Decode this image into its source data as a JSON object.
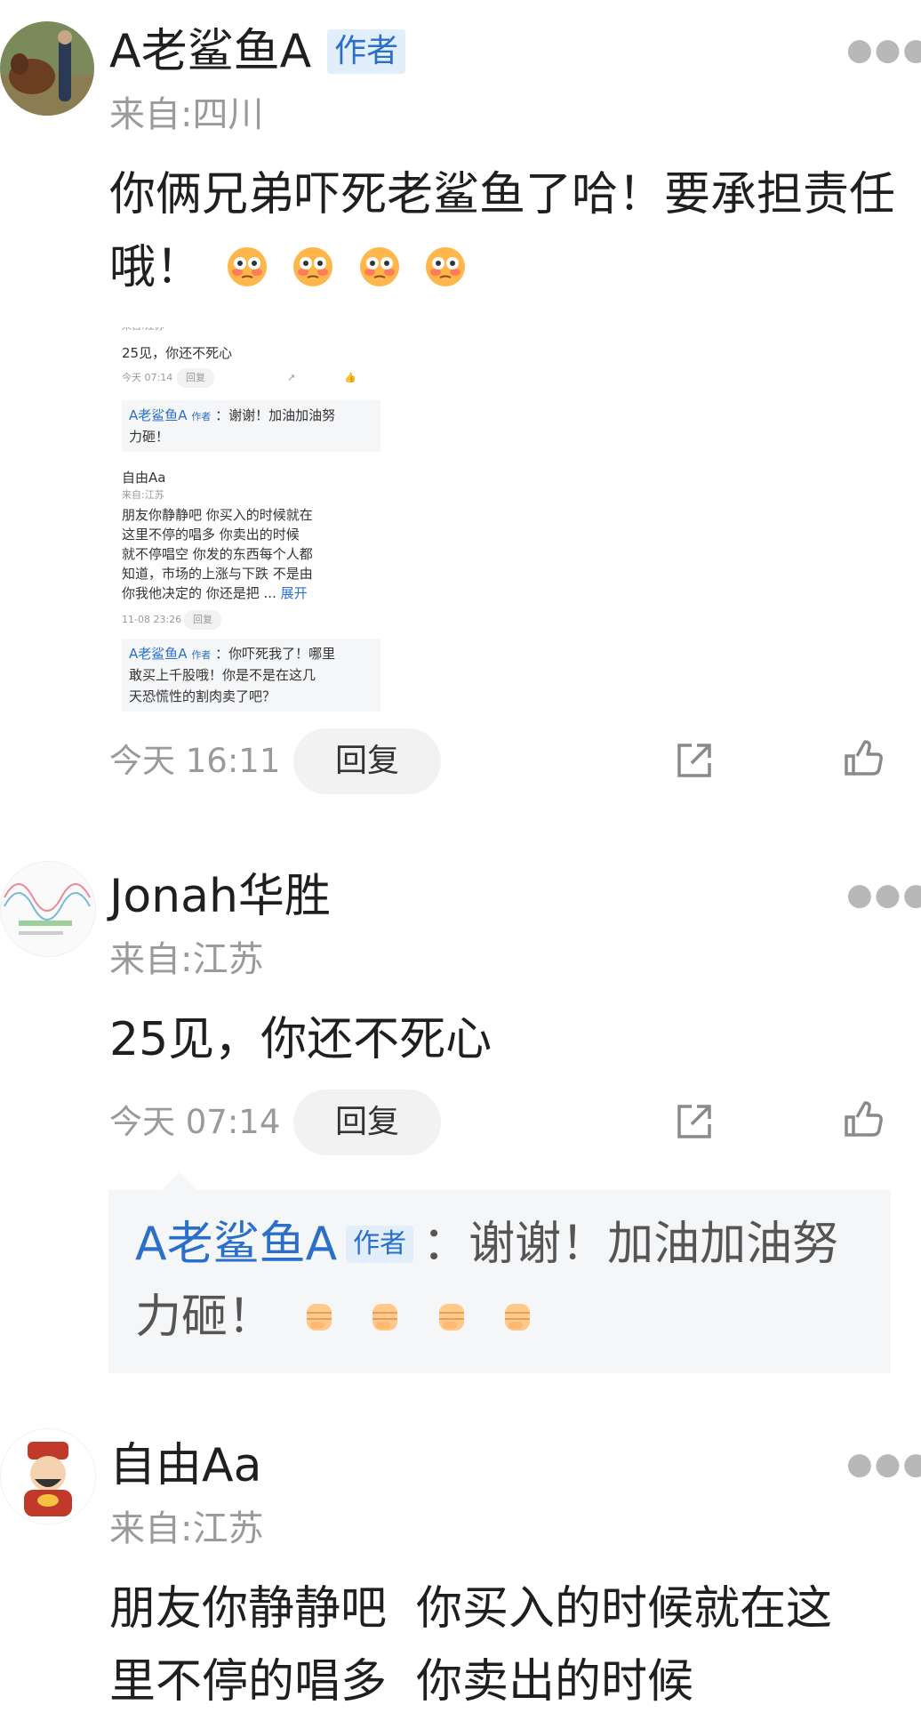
{
  "comments": [
    {
      "name": "A老鲨鱼A",
      "badge": "作者",
      "location": "来自:四川",
      "text": "你俩兄弟吓死老鲨鱼了哈！要承担责任哦！",
      "emoji": "flushed-face-emoji",
      "time": "今天 16:11",
      "reply": "回复"
    },
    {
      "name": "Jonah华胜",
      "location": "来自:江苏",
      "text": "25见，你还不死心",
      "time": "今天 07:14",
      "reply": "回复",
      "reply_thread": {
        "name": "A老鲨鱼A",
        "badge": "作者",
        "sep": "：",
        "text": "谢谢！加油加油努力砸！",
        "emoji": "fist-emoji"
      }
    },
    {
      "name": "自由Aa",
      "location": "来自:江苏",
      "text": "朋友你静静吧  你买入的时候就在这里不停的唱多  你卖出的时候"
    }
  ],
  "screenshot": {
    "top_loc": "来自:江苏",
    "c1_text": "25见，你还不死心",
    "c1_time": "今天 07:14",
    "c1_reply": "回复",
    "r1_name": "A老鲨鱼A",
    "r1_badge": "作者",
    "r1_text": "：谢谢！加油加油努",
    "r1_text2": "力砸！",
    "c2_name": "自由Aa",
    "c2_loc": "来自:江苏",
    "c2_l1": "朋友你静静吧  你买入的时候就在",
    "c2_l2": "这里不停的唱多  你卖出的时候",
    "c2_l3": "就不停唱空  你发的东西每个人都",
    "c2_l4": "知道，市场的上涨与下跌  不是由",
    "c2_l5": "你我他决定的  你还是把 ...",
    "c2_expand": "展开",
    "c2_time": "11-08 23:26",
    "c2_reply": "回复",
    "r2_name": "A老鲨鱼A",
    "r2_badge": "作者",
    "r2_text": "：你吓死我了！哪里",
    "r2_l2": "敢买上千股哦！你是不是在这几",
    "r2_l3": "天恐慌性的割肉卖了吧？"
  },
  "colors": {
    "link": "#2a6fc9",
    "badge_bg": "#e3eefb",
    "muted": "#9a9a9a"
  }
}
